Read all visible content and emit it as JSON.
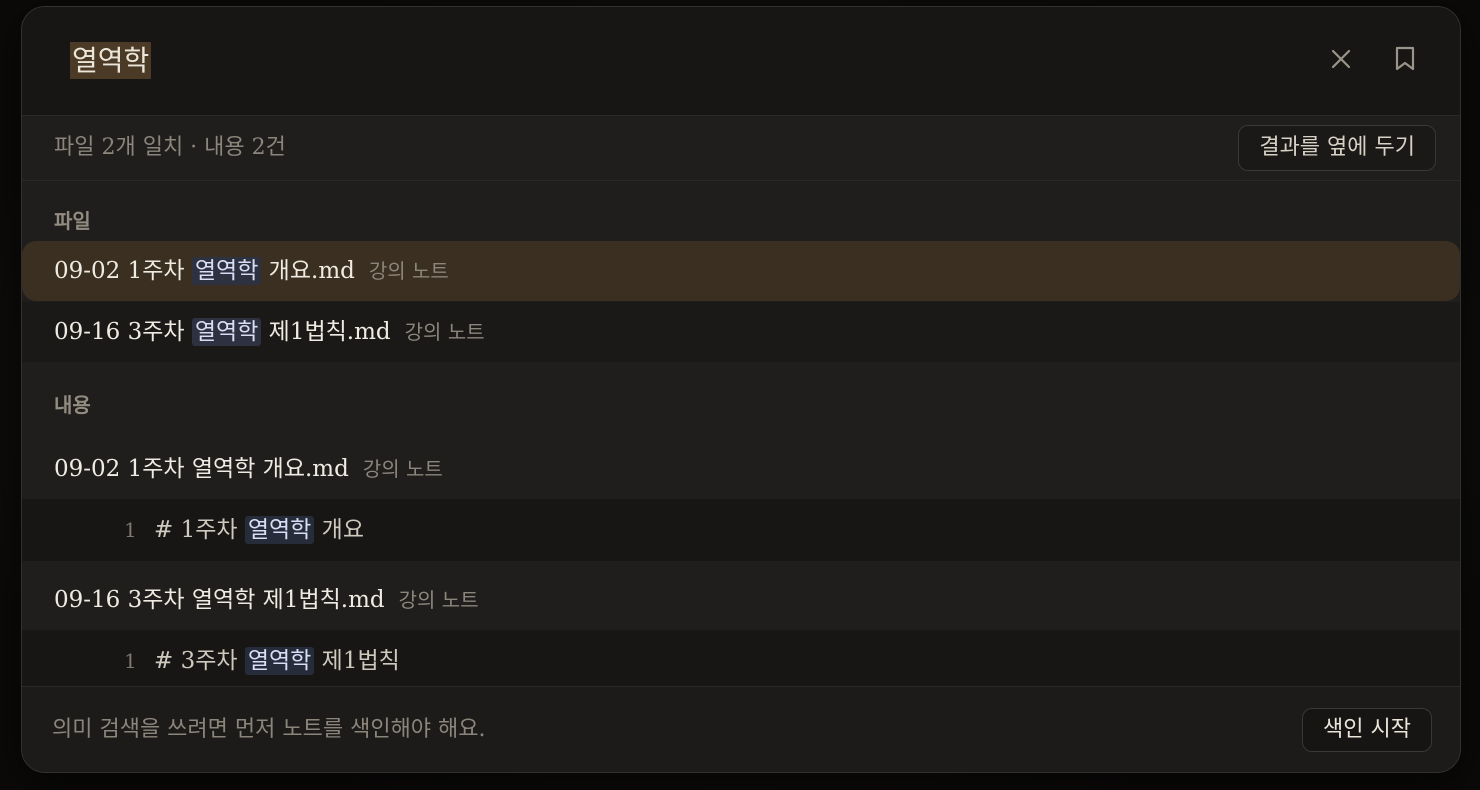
{
  "search": {
    "query": "열역학"
  },
  "header": {
    "close_icon": "close-icon",
    "bookmark_icon": "bookmark-icon"
  },
  "summary": {
    "text": "파일 2개 일치 · 내용 2건",
    "side_button_label": "결과를 옆에 두기"
  },
  "sections": {
    "files_label": "파일",
    "content_label": "내용"
  },
  "file_results": [
    {
      "prefix": "09-02 1주차 ",
      "match": "열역학",
      "suffix": " 개요.md",
      "meta": "강의 노트"
    },
    {
      "prefix": "09-16 3주차 ",
      "match": "열역학",
      "suffix": " 제1법칙.md",
      "meta": "강의 노트"
    }
  ],
  "content_results": [
    {
      "file": "09-02 1주차 열역학 개요.md",
      "meta": "강의 노트",
      "line_no": "1",
      "line_prefix": "# 1주차 ",
      "line_match": "열역학",
      "line_suffix": " 개요"
    },
    {
      "file": "09-16 3주차 열역학 제1법칙.md",
      "meta": "강의 노트",
      "line_no": "1",
      "line_prefix": "# 3주차 ",
      "line_match": "열역학",
      "line_suffix": " 제1법칙"
    }
  ],
  "footer": {
    "text": "의미 검색을 쓰려면 먼저 노트를 색인해야 해요.",
    "index_button_label": "색인 시작"
  },
  "colors": {
    "selected_row": "#3a2f20",
    "highlight": "#2e3240",
    "query_highlight": "#4a3a26"
  }
}
